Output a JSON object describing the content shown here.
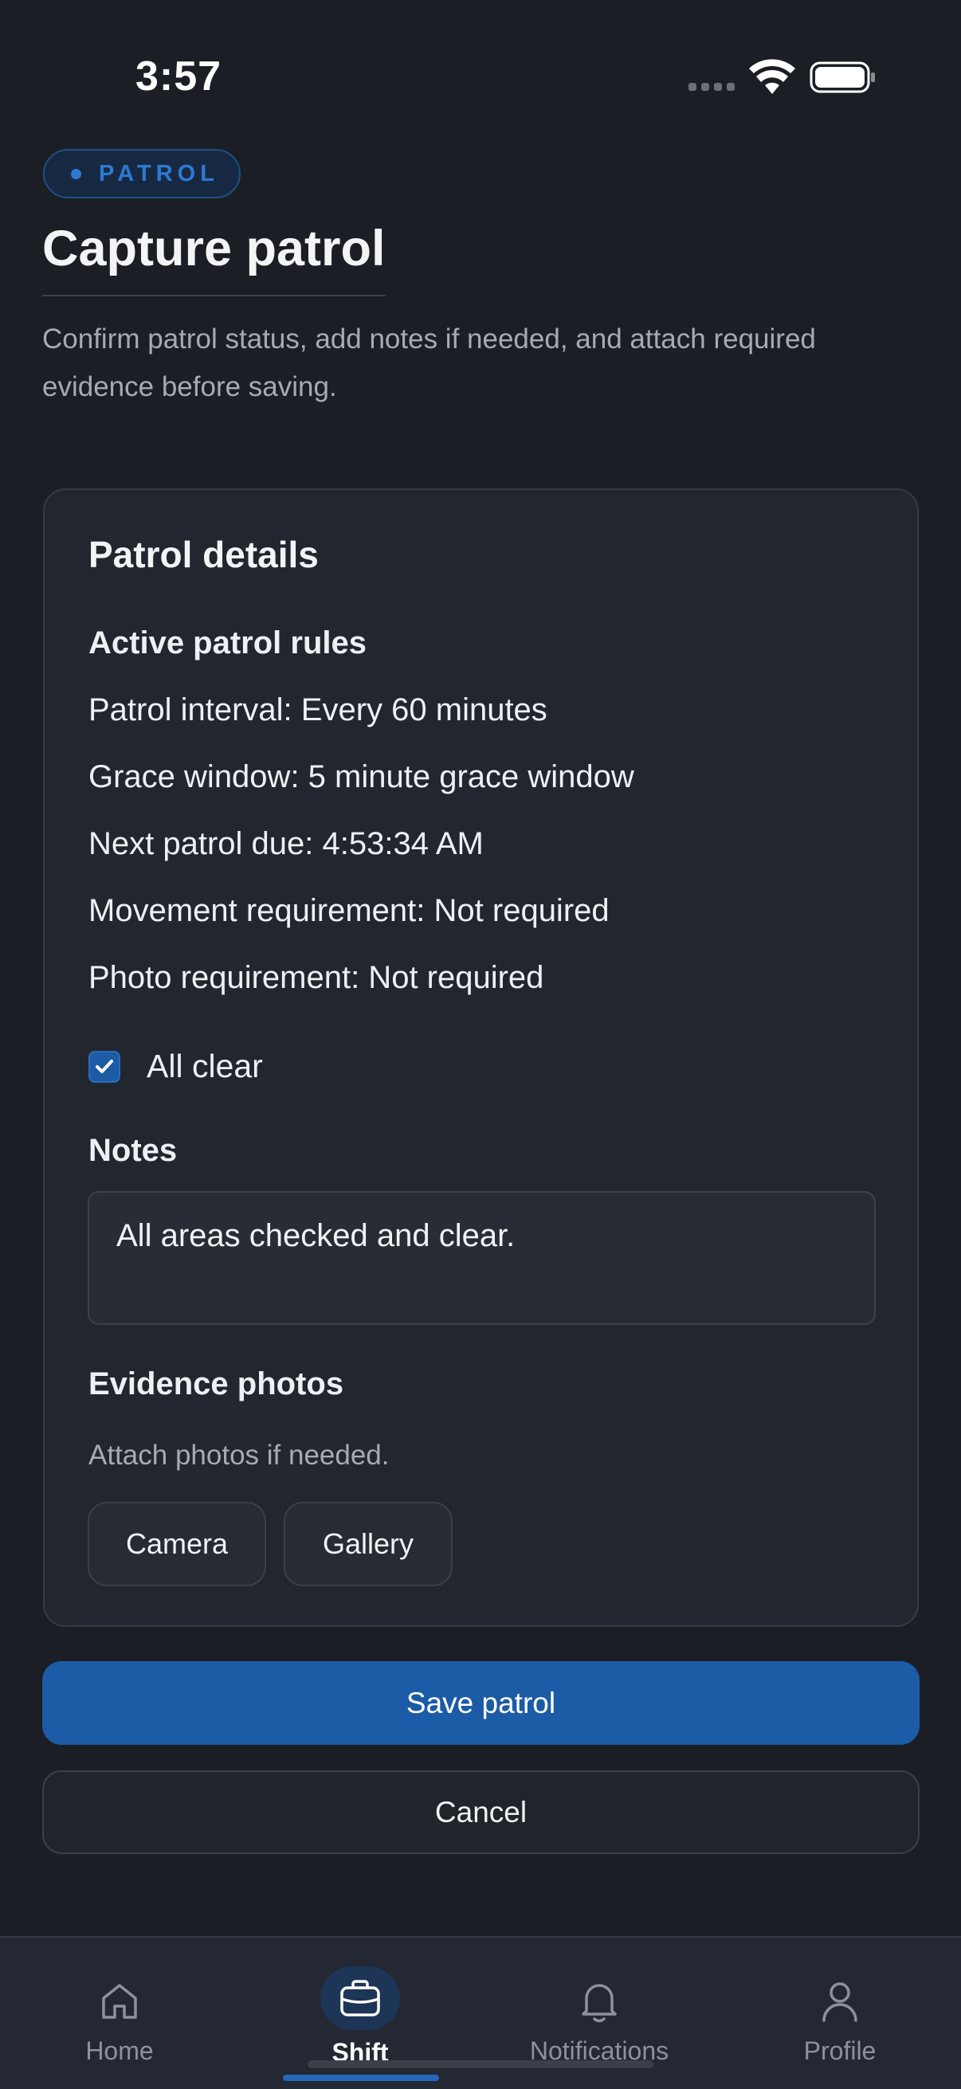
{
  "status_bar": {
    "time": "3:57"
  },
  "header": {
    "badge": "PATROL",
    "title": "Capture patrol",
    "description": "Confirm patrol status, add notes if needed, and attach required evidence before saving."
  },
  "card": {
    "title": "Patrol details",
    "rules_heading": "Active patrol rules",
    "rules": [
      "Patrol interval: Every 60 minutes",
      "Grace window: 5 minute grace window",
      "Next patrol due: 4:53:34 AM",
      "Movement requirement: Not required",
      "Photo requirement: Not required"
    ],
    "all_clear": {
      "label": "All clear",
      "checked": true
    },
    "notes": {
      "label": "Notes",
      "value": "All areas checked and clear."
    },
    "evidence": {
      "label": "Evidence photos",
      "hint": "Attach photos if needed.",
      "camera_label": "Camera",
      "gallery_label": "Gallery"
    }
  },
  "actions": {
    "save_label": "Save patrol",
    "cancel_label": "Cancel"
  },
  "tab_bar": {
    "tabs": [
      {
        "label": "Home",
        "icon": "home-icon",
        "active": false
      },
      {
        "label": "Shift",
        "icon": "briefcase-icon",
        "active": true
      },
      {
        "label": "Notifications",
        "icon": "bell-icon",
        "active": false
      },
      {
        "label": "Profile",
        "icon": "person-icon",
        "active": false
      }
    ]
  },
  "colors": {
    "background": "#1b1e24",
    "card": "#22262e",
    "accent": "#1c5ba6",
    "muted_text": "#a5abb5"
  }
}
